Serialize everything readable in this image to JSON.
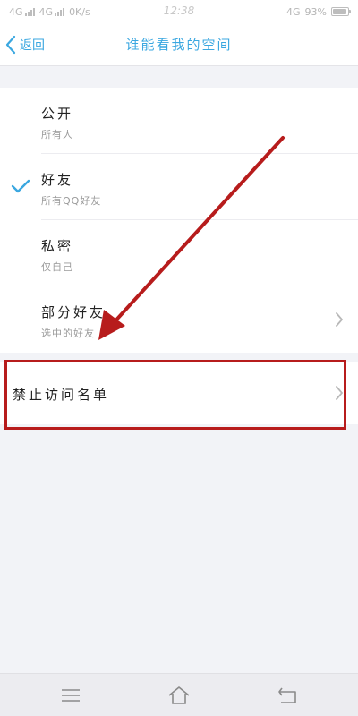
{
  "status_bar": {
    "network_1": "4G",
    "network_2": "4G",
    "speed": "0K/s",
    "time": "12:38",
    "right_network": "4G",
    "battery": "93%",
    "battery_level": 0.93
  },
  "nav": {
    "back_label": "返回",
    "title": "谁能看我的空间"
  },
  "options": [
    {
      "title": "公开",
      "desc": "所有人",
      "selected": false,
      "has_chevron": false
    },
    {
      "title": "好友",
      "desc": "所有QQ好友",
      "selected": true,
      "has_chevron": false
    },
    {
      "title": "私密",
      "desc": "仅自己",
      "selected": false,
      "has_chevron": false
    },
    {
      "title": "部分好友",
      "desc": "选中的好友",
      "selected": false,
      "has_chevron": true
    }
  ],
  "blocklist": {
    "title": "禁止访问名单"
  },
  "colors": {
    "accent": "#3aa7e0",
    "annotation": "#b71c1c"
  },
  "icons": {
    "back": "chevron-left-icon",
    "check": "check-icon",
    "chevron": "chevron-right-icon",
    "menu": "menu-icon",
    "home": "home-icon",
    "return": "return-icon"
  }
}
